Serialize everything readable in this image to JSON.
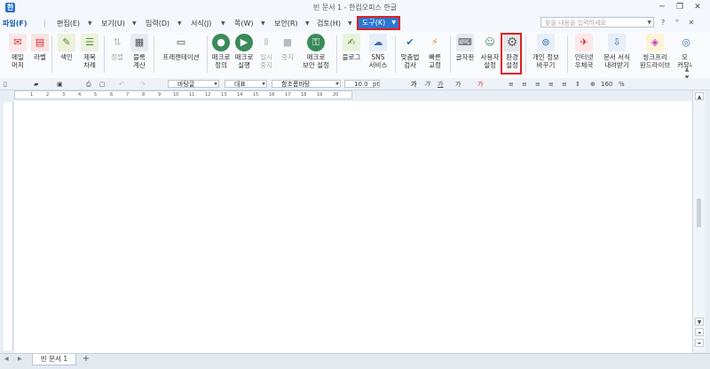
{
  "window": {
    "title": "빈 문서 1 - 한컴오피스 한글",
    "minimize": "─",
    "restore": "❐",
    "close": "✕"
  },
  "menubar": {
    "file": "파일(F)",
    "edit": "편집(E)",
    "view": "보기(U)",
    "insert": "입력(D)",
    "format": "서식(J)",
    "page": "쪽(W)",
    "security": "보안(R)",
    "review": "검토(H)",
    "tools": "도구(K)",
    "dropdown": "▼",
    "search_placeholder": "찾을 내용을 입력하세요"
  },
  "ribbon": {
    "mail_merge": "메일\n머지",
    "label": "라벨",
    "index": "색인",
    "title_toc": "제목\n차례",
    "sort": "정렬",
    "block_calc": "블록\n계산",
    "presentation": "프레젠테이션",
    "macro_define": "매크로\n정의",
    "macro_run": "매크로\n실행",
    "pause": "일시\n중지",
    "stop": "중지",
    "macro_security": "매크로\n보안 설정",
    "blog": "블로그",
    "sns": "SNS\n서비스",
    "spellcheck": "맞춤법\n검사",
    "quick_correct": "빠른\n교정",
    "keyboard": "글자판",
    "user_settings": "사용자\n설정",
    "preferences": "환경\n설정",
    "privacy": "개인 정보\n바꾸기",
    "internet_check": "인터넷\n우체국",
    "doc_format": "문서 서식\n내려받기",
    "thinkfree": "씽크프리\n원드라이브",
    "community": "오\n커뮤니"
  },
  "format_toolbar": {
    "style": "바탕글",
    "representative": "대표",
    "font": "함초롬바탕",
    "font_size": "10.0",
    "unit": "pt",
    "bold": "가",
    "italic": "가",
    "underline": "가",
    "strike": "가",
    "color": "가",
    "zoom": "160",
    "zoom_unit": "%"
  },
  "ruler": {
    "labels": [
      "1",
      "2",
      "3",
      "4",
      "5",
      "6",
      "7",
      "8",
      "9",
      "10",
      "11",
      "12",
      "13",
      "14",
      "15",
      "16",
      "17",
      "18",
      "19",
      "20"
    ]
  },
  "tabs": {
    "doc_tab": "빈 문서 1",
    "add": "+"
  },
  "icons": {
    "app": "hwp-app-icon",
    "settings": "gear-icon"
  }
}
